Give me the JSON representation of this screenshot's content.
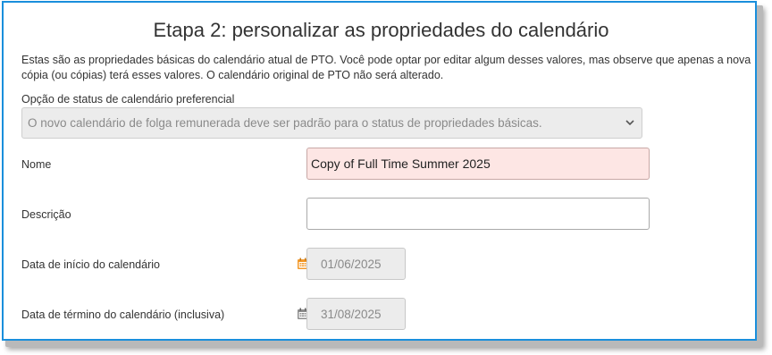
{
  "header": {
    "title": "Etapa 2: personalizar as propriedades do calendário"
  },
  "intro": {
    "text": "Estas são as propriedades básicas do calendário atual de PTO. Você pode optar por editar algum desses valores, mas observe que apenas a nova cópia (ou cópias) terá esses valores. O calendário original de PTO não será alterado."
  },
  "status_option": {
    "label": "Opção de status de calendário preferencial",
    "selected": "O novo calendário de folga remunerada deve ser padrão para o status de propriedades básicas.",
    "icon": "chevron-down-icon"
  },
  "name_field": {
    "label": "Nome",
    "value": "Copy of Full Time Summer 2025"
  },
  "description_field": {
    "label": "Descrição",
    "value": ""
  },
  "start_date_field": {
    "label": "Data de início do calendário",
    "value": "01/06/2025",
    "icon": "calendar-icon",
    "icon_color": "#f39a2b"
  },
  "end_date_field": {
    "label": "Data de término do calendário (inclusiva)",
    "value": "31/08/2025",
    "icon": "calendar-icon",
    "icon_color": "#8e8e8e"
  },
  "colors": {
    "frame_border": "#1a8fdc",
    "name_highlight": "#fde6e4"
  }
}
